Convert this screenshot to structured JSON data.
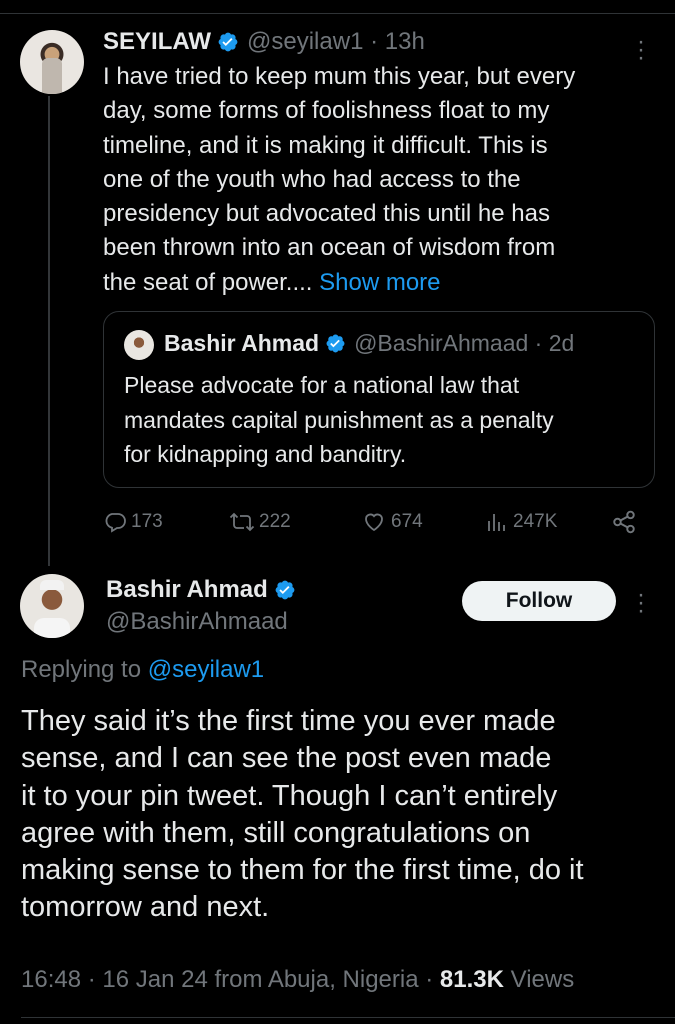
{
  "colors": {
    "background": "#000000",
    "text": "#e7e9ea",
    "muted": "#71767b",
    "link": "#1d9bf0",
    "verified": "#1d9bf0"
  },
  "tweet": {
    "display_name": "SEYILAW",
    "handle": "@seyilaw1",
    "time": "13h",
    "text_lines": [
      "I have tried to keep mum this year, but every",
      "day, some forms of foolishness float to my",
      "timeline, and it is making it difficult. This is",
      "one of the youth who had access to the",
      "presidency but advocated this until he has",
      "been thrown into an ocean of wisdom from",
      "the seat of power...."
    ],
    "show_more": "Show more",
    "quote": {
      "display_name": "Bashir Ahmad",
      "handle": "@BashirAhmaad",
      "time": "2d",
      "text_lines": [
        "Please advocate for a national law that",
        "mandates capital punishment as a penalty",
        "for kidnapping and banditry."
      ]
    },
    "actions": {
      "replies": "173",
      "retweets": "222",
      "likes": "674",
      "views": "247K"
    }
  },
  "reply": {
    "display_name": "Bashir Ahmad",
    "handle": "@BashirAhmaad",
    "follow_label": "Follow",
    "replying_prefix": "Replying to",
    "replying_handle": "@seyilaw1",
    "text_lines": [
      "They said it’s the first time you ever made",
      "sense, and I can see the post even made",
      "it to your pin tweet. Though I can’t entirely",
      "agree with them, still congratulations on",
      "making sense to them for the first time, do it",
      "tomorrow and next."
    ],
    "timestamp": "16:48 · 16 Jan 24 from Abuja, Nigeria ·",
    "views_count": "81.3K",
    "views_label": "Views"
  },
  "icons": [
    "verified-badge-icon",
    "more-options-icon",
    "reply-icon",
    "retweet-icon",
    "like-icon",
    "views-icon",
    "share-icon"
  ]
}
